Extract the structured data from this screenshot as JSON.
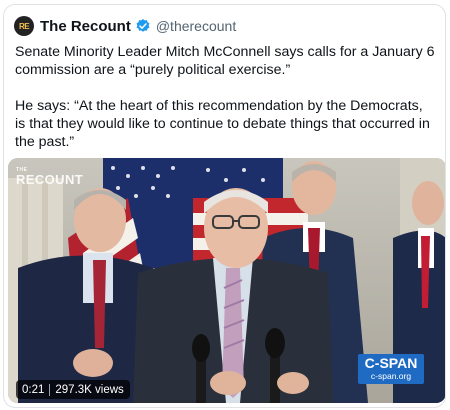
{
  "tweet": {
    "avatar_text": "RE",
    "display_name": "The Recount",
    "handle": "@therecount",
    "verified_icon": "verified-badge-icon",
    "text_paragraph_1": "Senate Minority Leader Mitch McConnell says calls for a January 6 commission are a “purely political exercise.”",
    "text_paragraph_2": "He says: “At the heart of this recommendation by the Democrats, is that they would like to continue to debate things that occurred in the past.”"
  },
  "media": {
    "watermark_small": "THE",
    "watermark": "RECOUNT",
    "cspan_logo": "C-SPAN",
    "cspan_url": "c-span.org",
    "duration": "0:21",
    "views": "297.3K views"
  },
  "colors": {
    "verified": "#1d9bf0",
    "handle": "#536471",
    "cspan_blue": "#1f6bc3"
  }
}
